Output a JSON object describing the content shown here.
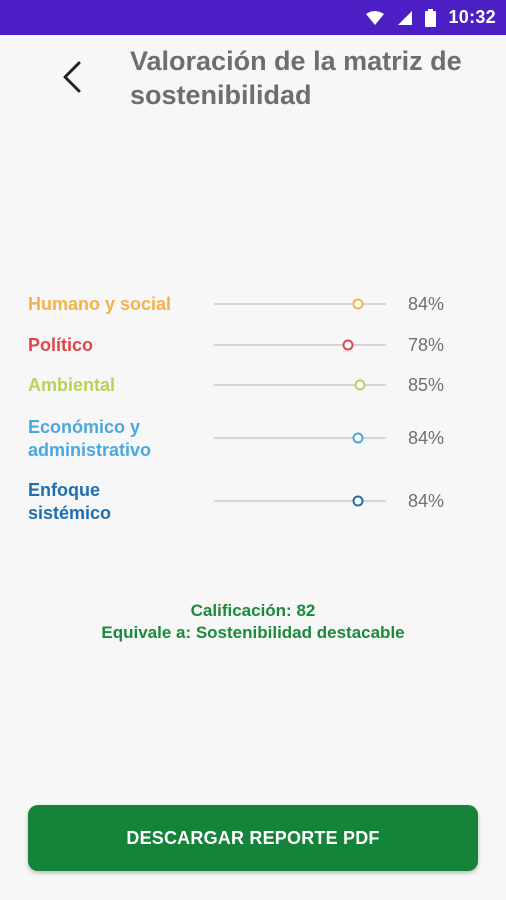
{
  "status_bar": {
    "time": "10:32",
    "bg_color": "#4b1fc3"
  },
  "header": {
    "back_icon": "chevron-left-icon",
    "title": "Valoración de la matriz de sostenibilidad"
  },
  "criteria": [
    {
      "label_lines": [
        "Humano y social"
      ],
      "value": 0.84,
      "value_text": "84%",
      "color": "#f6b24a"
    },
    {
      "label_lines": [
        "Político"
      ],
      "value": 0.78,
      "value_text": "78%",
      "color": "#e0454a"
    },
    {
      "label_lines": [
        "Ambiental"
      ],
      "value": 0.85,
      "value_text": "85%",
      "color": "#b6d35a"
    },
    {
      "label_lines": [
        "Económico y",
        "administrativo"
      ],
      "value": 0.84,
      "value_text": "84%",
      "color": "#4aa8e0"
    },
    {
      "label_lines": [
        "Enfoque",
        "sistémico"
      ],
      "value": 0.84,
      "value_text": "84%",
      "color": "#1d6fb0"
    }
  ],
  "result": {
    "score_text": "Calificación: 82",
    "equivalence_text": "Equivale a: Sostenibilidad destacable",
    "color": "#1b8a3a"
  },
  "download_button": {
    "label": "DESCARGAR REPORTE PDF",
    "color": "#13843a"
  }
}
